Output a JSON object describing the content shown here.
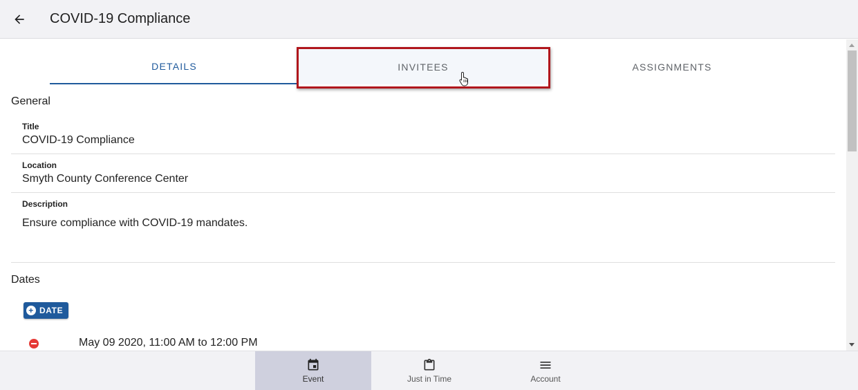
{
  "app_bar": {
    "title": "COVID-19 Compliance",
    "back_icon": "arrow-back-icon"
  },
  "tabs": [
    {
      "label": "DETAILS",
      "active": true
    },
    {
      "label": "INVITEES",
      "active": false,
      "highlighted": true
    },
    {
      "label": "ASSIGNMENTS",
      "active": false
    }
  ],
  "general": {
    "heading": "General",
    "fields": [
      {
        "label": "Title",
        "value": "COVID-19 Compliance"
      },
      {
        "label": "Location",
        "value": "Smyth County Conference Center"
      },
      {
        "label": "Description",
        "value": "Ensure compliance with COVID-19 mandates."
      }
    ]
  },
  "dates": {
    "heading": "Dates",
    "add_button_label": "DATE",
    "items": [
      {
        "text": "May 09 2020, 11:00 AM to 12:00 PM"
      }
    ]
  },
  "bottom_nav": [
    {
      "label": "Event",
      "icon": "calendar-icon",
      "active": true
    },
    {
      "label": "Just in Time",
      "icon": "clipboard-icon",
      "active": false
    },
    {
      "label": "Account",
      "icon": "menu-icon",
      "active": false
    }
  ],
  "colors": {
    "accent": "#1f5a9c",
    "highlight_border": "#b0161c",
    "remove": "#e53935",
    "active_nav": "#cfd0de"
  }
}
